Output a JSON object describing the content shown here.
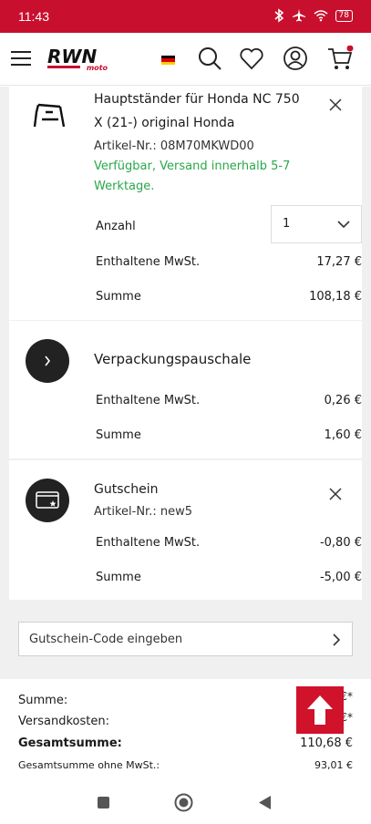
{
  "status_bar": {
    "time": "11:43",
    "battery": "78"
  },
  "header": {
    "logo_text": "RWN",
    "logo_sub": "moto",
    "colors": {
      "brand_red": "#c8102e",
      "available_green": "#2aa84a"
    }
  },
  "items": [
    {
      "title_line1": "Hauptständer für Honda NC 750",
      "title_line2": "X (21-) original Honda",
      "article": "Artikel-Nr.: 08M70MKWD00",
      "availability_line1": "Verfügbar, Versand innerhalb 5-7",
      "availability_line2": "Werktage.",
      "qty_label": "Anzahl",
      "qty_value": "1",
      "vat_label": "Enthaltene MwSt.",
      "vat_value": "17,27 €",
      "sum_label": "Summe",
      "sum_value": "108,18 €"
    },
    {
      "title": "Verpackungspauschale",
      "vat_label": "Enthaltene MwSt.",
      "vat_value": "0,26 €",
      "sum_label": "Summe",
      "sum_value": "1,60 €"
    },
    {
      "title": "Gutschein",
      "article": "Artikel-Nr.: new5",
      "vat_label": "Enthaltene MwSt.",
      "vat_value": "-0,80 €",
      "sum_label": "Summe",
      "sum_value": "-5,00 €"
    }
  ],
  "voucher": {
    "label": "Gutschein-Code eingeben"
  },
  "totals": {
    "sum_label": "Summe:",
    "sum_value": "€*",
    "shipping_label": "Versandkosten:",
    "shipping_value": "€*",
    "grand_label": "Gesamtsumme:",
    "grand_value": "110,68 €",
    "net_label": "Gesamtsumme ohne MwSt.:",
    "net_value": "93,01 €"
  }
}
